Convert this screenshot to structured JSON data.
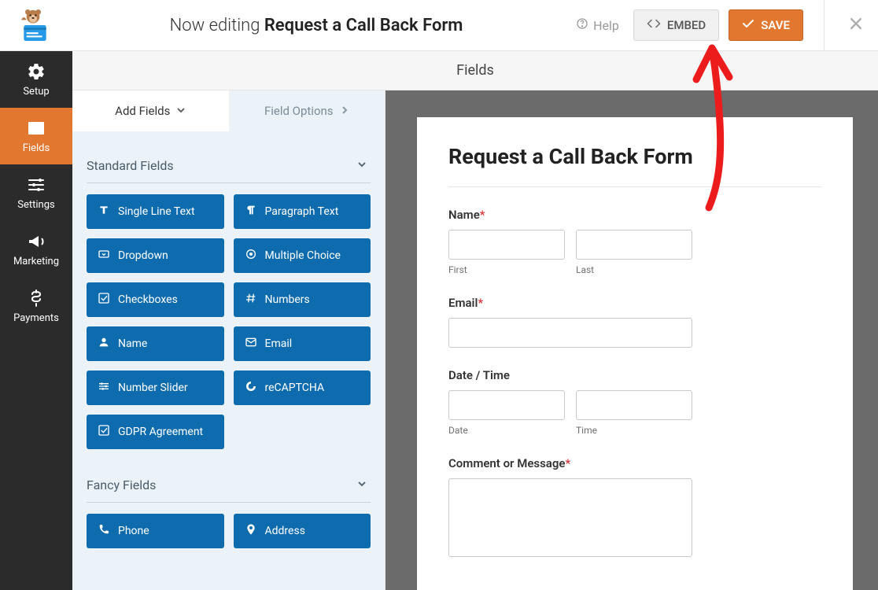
{
  "header": {
    "editing_prefix": "Now editing",
    "form_name": "Request a Call Back Form",
    "help": "Help",
    "embed": "EMBED",
    "save": "SAVE"
  },
  "leftnav": [
    {
      "key": "setup",
      "label": "Setup"
    },
    {
      "key": "fields",
      "label": "Fields"
    },
    {
      "key": "settings",
      "label": "Settings"
    },
    {
      "key": "marketing",
      "label": "Marketing"
    },
    {
      "key": "payments",
      "label": "Payments"
    }
  ],
  "panel_title": "Fields",
  "tabs": {
    "add": "Add Fields",
    "options": "Field Options"
  },
  "sections": {
    "standard": "Standard Fields",
    "fancy": "Fancy Fields"
  },
  "standard_fields": [
    "Single Line Text",
    "Paragraph Text",
    "Dropdown",
    "Multiple Choice",
    "Checkboxes",
    "Numbers",
    "Name",
    "Email",
    "Number Slider",
    "reCAPTCHA",
    "GDPR Agreement"
  ],
  "fancy_fields": [
    "Phone",
    "Address"
  ],
  "preview": {
    "title": "Request a Call Back Form",
    "fields": {
      "name": {
        "label": "Name",
        "required": true,
        "sub_first": "First",
        "sub_last": "Last"
      },
      "email": {
        "label": "Email",
        "required": true
      },
      "datetime": {
        "label": "Date / Time",
        "required": false,
        "sub_date": "Date",
        "sub_time": "Time"
      },
      "comment": {
        "label": "Comment or Message",
        "required": true
      }
    }
  }
}
